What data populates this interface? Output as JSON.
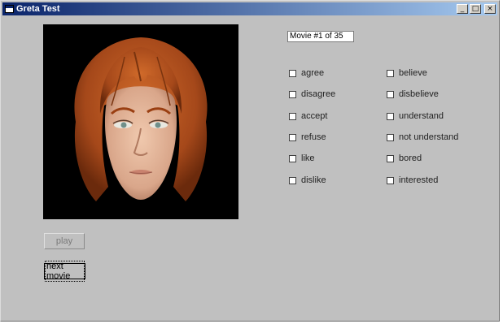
{
  "window": {
    "title": "Greta Test",
    "controls": {
      "minimize": "_",
      "maximize": "□",
      "close": "×"
    }
  },
  "movie_field": {
    "value": "Movie #1 of 35"
  },
  "checkboxes_left": [
    {
      "label": "agree",
      "checked": false
    },
    {
      "label": "disagree",
      "checked": false
    },
    {
      "label": "accept",
      "checked": false
    },
    {
      "label": "refuse",
      "checked": false
    },
    {
      "label": "like",
      "checked": false
    },
    {
      "label": "dislike",
      "checked": false
    }
  ],
  "checkboxes_right": [
    {
      "label": "believe",
      "checked": false
    },
    {
      "label": "disbelieve",
      "checked": false
    },
    {
      "label": "understand",
      "checked": false
    },
    {
      "label": "not understand",
      "checked": false
    },
    {
      "label": "bored",
      "checked": false
    },
    {
      "label": "interested",
      "checked": false
    }
  ],
  "buttons": {
    "play_label": "play",
    "next_label": "next movie"
  },
  "colors": {
    "window_bg": "#c0c0c0",
    "title_start": "#0a246a",
    "title_end": "#a6caf0",
    "hair": "#b5541c",
    "skin": "#e3b598"
  }
}
